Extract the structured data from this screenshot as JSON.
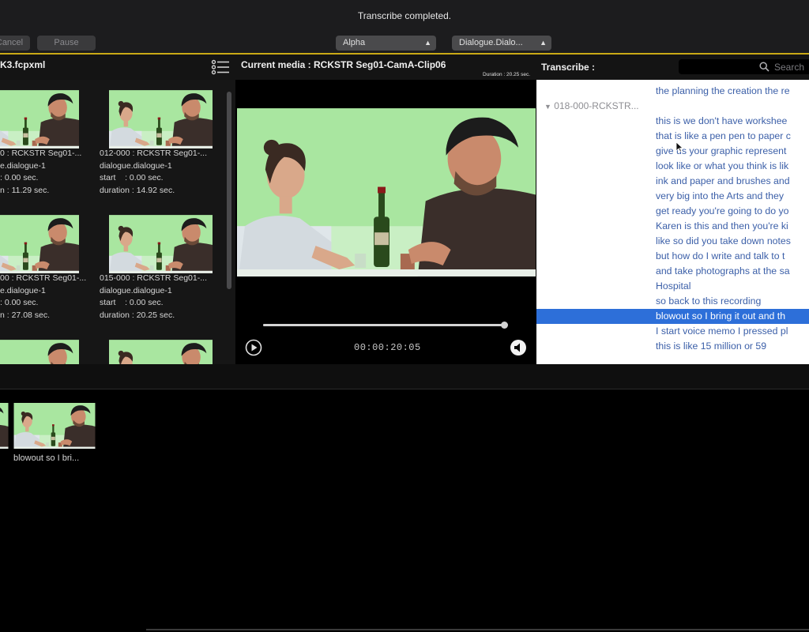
{
  "toolbar": {
    "status": "Transcribe completed.",
    "cancel_label": "Cancel",
    "pause_label": "Pause",
    "alpha_select": "Alpha",
    "dialogue_select": "Dialogue.Dialo...",
    "accent_color": "#c9a916"
  },
  "left_panel": {
    "title": "K3.fcpxml",
    "clips": [
      {
        "line1": "0 : RCKSTR Seg01-...",
        "line2": "e.dialogue-1",
        "line3": ": 0.00 sec.",
        "line4": "n : 11.29 sec."
      },
      {
        "line1": "012-000 : RCKSTR Seg01-...",
        "line2": "dialogue.dialogue-1",
        "line3": "start    : 0.00 sec.",
        "line4": "duration : 14.92 sec."
      },
      {
        "line1": "00 : RCKSTR Seg01-...",
        "line2": "e.dialogue-1",
        "line3": ": 0.00 sec.",
        "line4": "n : 27.08 sec."
      },
      {
        "line1": "015-000 : RCKSTR Seg01-...",
        "line2": "dialogue.dialogue-1",
        "line3": "start    : 0.00 sec.",
        "line4": "duration : 20.25 sec."
      }
    ]
  },
  "media": {
    "title": "Current media : RCKSTR Seg01-CamA-Clip06",
    "duration": "Duration : 20.25 sec.",
    "timecode": "00:00:20:05",
    "progress": 1.0
  },
  "transcribe": {
    "title": "Transcribe :",
    "search_placeholder": "Search",
    "clip_node": "018-000-RCKSTR...",
    "lines": [
      "the planning the creation the re",
      "",
      "this is we don't have workshee",
      "that is like a pen pen to paper c",
      "give us your graphic represent",
      "look like or what you think is lik",
      "ink and paper and brushes and",
      "very big into the Arts and they",
      "get ready you're going to do yo",
      "Karen is this and then you're ki",
      "like so did you take down notes",
      "but how do I write and talk to t",
      "and take photographs at the sa",
      "Hospital",
      "so back to this recording",
      "blowout so I bring it out and th",
      "I start voice memo I pressed pl",
      "this is like 15 million or 59"
    ],
    "selected_index": 15,
    "selection_color": "#2d6fd9"
  },
  "bottom": {
    "caption": "blowout so I bri..."
  }
}
